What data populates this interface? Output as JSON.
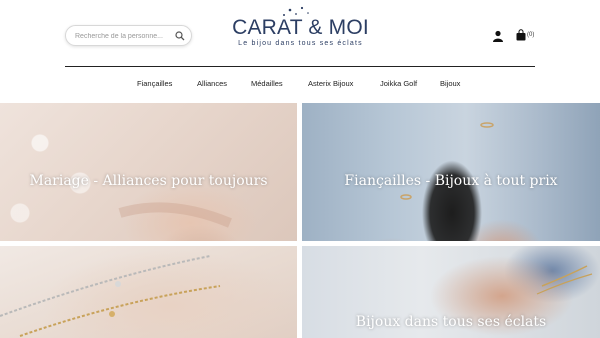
{
  "header": {
    "search": {
      "placeholder": "Recherche de la personne...",
      "icon": "search-icon"
    },
    "logo": {
      "brand": "CARAT & MOI",
      "tagline": "Le bijou dans tous ses éclats",
      "color": "#2c3e63"
    },
    "account_icon": "user-icon",
    "cart": {
      "icon": "shopping-bag-icon",
      "count": "(0)"
    }
  },
  "nav": {
    "items": [
      {
        "label": "Fiançailles"
      },
      {
        "label": "Alliances"
      },
      {
        "label": "Médailles"
      },
      {
        "label": "Asterix Bijoux"
      },
      {
        "label": "Joikka Golf"
      },
      {
        "label": "Bijoux"
      }
    ]
  },
  "tiles": [
    {
      "caption": "Mariage - Alliances pour toujours"
    },
    {
      "caption": "Fiançailles - Bijoux à tout prix"
    },
    {
      "caption": ""
    },
    {
      "caption": "Bijoux dans tous ses éclats"
    }
  ]
}
